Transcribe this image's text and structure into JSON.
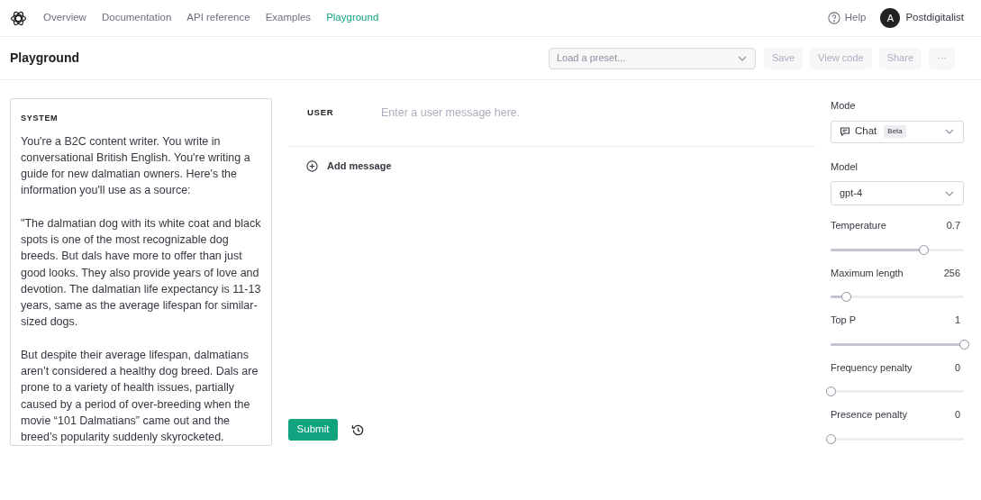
{
  "nav": {
    "items": [
      {
        "label": "Overview",
        "selected": false
      },
      {
        "label": "Documentation",
        "selected": false
      },
      {
        "label": "API reference",
        "selected": false
      },
      {
        "label": "Examples",
        "selected": false
      },
      {
        "label": "Playground",
        "selected": true
      }
    ],
    "help": "Help",
    "user": {
      "initial": "A",
      "name": "Postdigitalist"
    }
  },
  "toolbar": {
    "title": "Playground",
    "preset": {
      "placeholder": "Load a preset..."
    },
    "buttons": [
      "Save",
      "View code",
      "Share",
      "···"
    ]
  },
  "system": {
    "label": "SYSTEM",
    "paragraphs": [
      "You're a B2C content writer. You write in conversational British English. You're writing a guide for new dalmatian owners. Here's the information you'll use as a source:",
      "\"The dalmatian dog with its white coat and black spots is one of the most recognizable dog breeds. But dals have more to offer than just good looks. They also provide years of love and devotion. The dalmatian life expectancy is 11-13 years, same as the average lifespan for similar-sized dogs.",
      "But despite their average lifespan, dalmatians aren’t considered a healthy dog breed. Dals are prone to a variety of health issues, partially caused by a period of over-breeding when the movie “101 Dalmatians” came out and the breed’s popularity suddenly skyrocketed."
    ]
  },
  "chat": {
    "role": "USER",
    "placeholder": "Enter a user message here.",
    "add": "Add message",
    "submit": "Submit"
  },
  "settings": {
    "mode": {
      "label": "Mode",
      "value": "Chat",
      "badge": "Beta"
    },
    "model": {
      "label": "Model",
      "value": "gpt-4"
    },
    "sliders": [
      {
        "label": "Temperature",
        "reading": "0.7",
        "level": 0.7
      },
      {
        "label": "Maximum length",
        "reading": "256",
        "level": 0.12
      },
      {
        "label": "Top P",
        "reading": "1",
        "level": 1
      },
      {
        "label": "Frequency penalty",
        "reading": "0",
        "level": 0
      },
      {
        "label": "Presence penalty",
        "reading": "0",
        "level": 0
      }
    ]
  }
}
